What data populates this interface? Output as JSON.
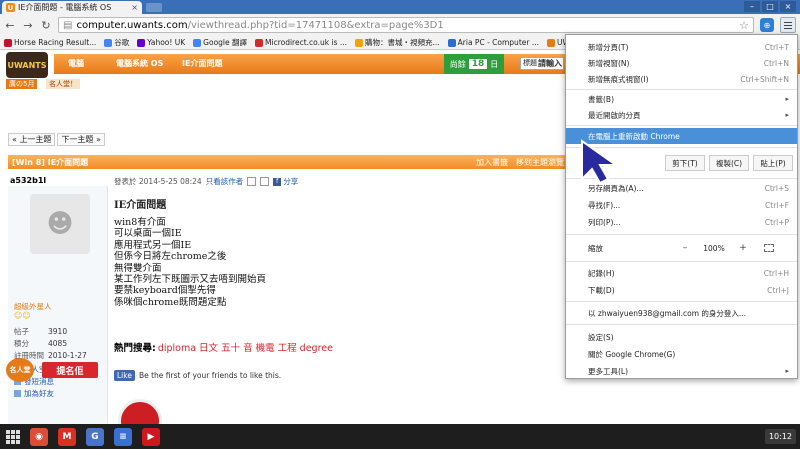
{
  "tab": {
    "title": "IE介面問題 - 電腦系統 OS",
    "favicon": "U",
    "close": "×"
  },
  "window": {
    "min": "–",
    "max": "□",
    "close": "×"
  },
  "toolbar": {
    "back": "←",
    "forward": "→",
    "reload": "↻",
    "url_host": "computer.uwants.com",
    "url_path": "/viewthread.php?tid=17471108&extra=page%3D1",
    "star": "☆",
    "ext": "⊕"
  },
  "bookmarks": [
    {
      "label": "Horse Racing Result...",
      "color": "#c8102e"
    },
    {
      "label": "谷歌",
      "color": "#4285f4"
    },
    {
      "label": "Yahoo! UK",
      "color": "#6001d2"
    },
    {
      "label": "Google 翻譯",
      "color": "#4285f4"
    },
    {
      "label": "Microdirect.co.uk is ...",
      "color": "#d62828"
    },
    {
      "label": "購物：書城・視頻充...",
      "color": "#f4a300"
    },
    {
      "label": "Aria PC - Computer ...",
      "color": "#2a6cd1"
    },
    {
      "label": "UWANTS",
      "color": "#e77a18"
    },
    {
      "label": "M",
      "color": "#888888"
    }
  ],
  "site": {
    "logo": "UWANTS",
    "crumb_home": "電腦",
    "crumb_forum": "電腦系統 OS",
    "crumb_thread": "IE介面問題",
    "online_label": "尚餘",
    "online_days": "18",
    "online_unit": "日",
    "search_select": "標題",
    "search_text": "請輸入",
    "month_badge": "廣の5月",
    "month_badge2": "名人堂！"
  },
  "pager": {
    "prev": "« 上一主題",
    "next": "下一主題 »"
  },
  "thread": {
    "title": "[Win 8] IE介面問題",
    "join": "加入書籤",
    "move": "移到主題瀏覽"
  },
  "post": {
    "author": "a532b1l",
    "meta": "發表於 2014-5-25 08:24",
    "only_author": "只看該作者",
    "share": "分享",
    "rank": "超級外星人",
    "stars": "☺☺",
    "stats": [
      {
        "k": "帖子",
        "v": "3910"
      },
      {
        "k": "積分",
        "v": "4085"
      },
      {
        "k": "註冊時間",
        "v": "2010-1-27"
      }
    ],
    "links": [
      "個人空間",
      "發短消息",
      "加為好友"
    ],
    "vip": "名人堂",
    "nominate": "提名佢",
    "title": "IE介面問題",
    "body": [
      "win8有介面",
      "可以桌面一個IE",
      "應用程式另一個IE",
      "但係今日將左chrome之後",
      "無得雙介面",
      "某工作列左下既圖示又去唔到開始頁",
      "要禁keyboard個掣先得",
      "係咪個chrome既問題定點"
    ],
    "hot_label": "熱門搜尋:",
    "hot_links": "diploma 日文 五十 音 機電 工程 degree",
    "like_btn": "Like",
    "like_text": "Be the first of your friends to like this."
  },
  "menu": {
    "items_top": [
      {
        "label": "新增分頁(T)",
        "sc": "Ctrl+T"
      },
      {
        "label": "新增視窗(N)",
        "sc": "Ctrl+N"
      },
      {
        "label": "新增無痕式視窗(I)",
        "sc": "Ctrl+Shift+N"
      },
      {
        "label": "書籤(B)",
        "sc": "▸"
      },
      {
        "label": "最近開啟的分頁",
        "sc": "▸"
      }
    ],
    "highlight": "在電腦上重新啟動 Chrome",
    "edit_label": "編輯",
    "cut": "剪下(T)",
    "copy": "複製(C)",
    "paste": "貼上(P)",
    "items_mid": [
      {
        "label": "另存網頁為(A)...",
        "sc": "Ctrl+S"
      },
      {
        "label": "尋找(F)...",
        "sc": "Ctrl+F"
      },
      {
        "label": "列印(P)...",
        "sc": "Ctrl+P"
      }
    ],
    "zoom_label": "縮放",
    "zoom_minus": "–",
    "zoom_value": "100%",
    "zoom_plus": "+",
    "items_hist": [
      {
        "label": "記錄(H)",
        "sc": "Ctrl+H"
      },
      {
        "label": "下載(D)",
        "sc": "Ctrl+J"
      }
    ],
    "signin": "以 zhwaiyuen938@gmail.com 的身分登入...",
    "items_bottom": [
      {
        "label": "設定(S)",
        "sc": ""
      },
      {
        "label": "關於 Google Chrome(G)",
        "sc": ""
      },
      {
        "label": "更多工具(L)",
        "sc": "▸"
      }
    ]
  },
  "shelf": {
    "apps": [
      {
        "name": "chrome",
        "label": "◉",
        "color": "#dd4b39"
      },
      {
        "name": "gmail",
        "label": "M",
        "color": "#d93025"
      },
      {
        "name": "gplus",
        "label": "G",
        "color": "#4a74c9"
      },
      {
        "name": "docs",
        "label": "≡",
        "color": "#3b6fd1"
      },
      {
        "name": "youtube",
        "label": "▶",
        "color": "#cc181e"
      }
    ],
    "time": "10:12"
  }
}
